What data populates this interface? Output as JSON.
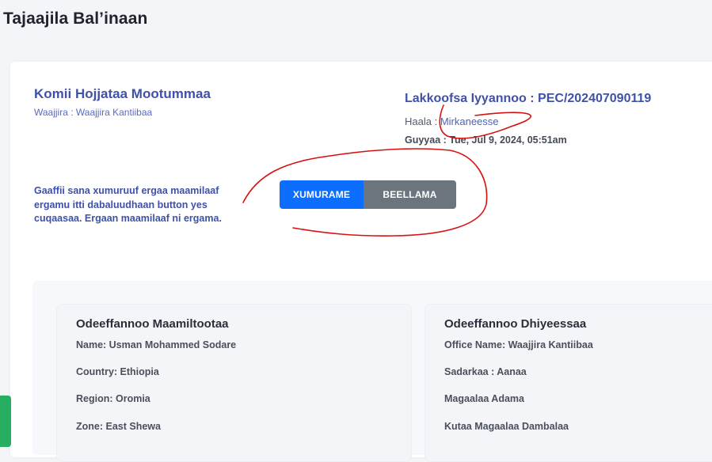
{
  "page": {
    "title": "Tajaajila Bal’inaan"
  },
  "header": {
    "org_name": "Komii Hojjataa Mootummaa",
    "office_label": "Waajjira : Waajjira Kantiibaa",
    "reference": "Lakkoofsa Iyyannoo : PEC/202407090119",
    "status_label": "Haala : ",
    "status_value": "Mirkaneesse",
    "date": "Guyyaa : Tue, Jul 9, 2024, 05:51am"
  },
  "instructions": "Gaaffii sana xumuruuf ergaa maamilaaf ergamu itti dabaluudhaan button yes cuqaasaa. Ergaan maamilaaf ni ergama.",
  "buttons": {
    "complete": "XUMURAME",
    "reject": "BEELLAMA"
  },
  "customer_card": {
    "title": "Odeeffannoo Maamiltootaa",
    "fields": [
      "Name: Usman Mohammed Sodare",
      "Country: Ethiopia",
      "Region: Oromia",
      "Zone: East Shewa"
    ]
  },
  "office_card": {
    "title": "Odeeffannoo Dhiyeessaa",
    "fields": [
      "Office Name: Waajjira Kantiibaa",
      "Sadarkaa : Aanaa",
      "Magaalaa Adama",
      "Kutaa Magaalaa Dambalaa"
    ]
  },
  "colors": {
    "primary": "#0d6efd",
    "secondary": "#6c757d",
    "heading_blue": "#3f51a8",
    "annotation_red": "#d81010",
    "side_tab_green": "#27ae60"
  }
}
